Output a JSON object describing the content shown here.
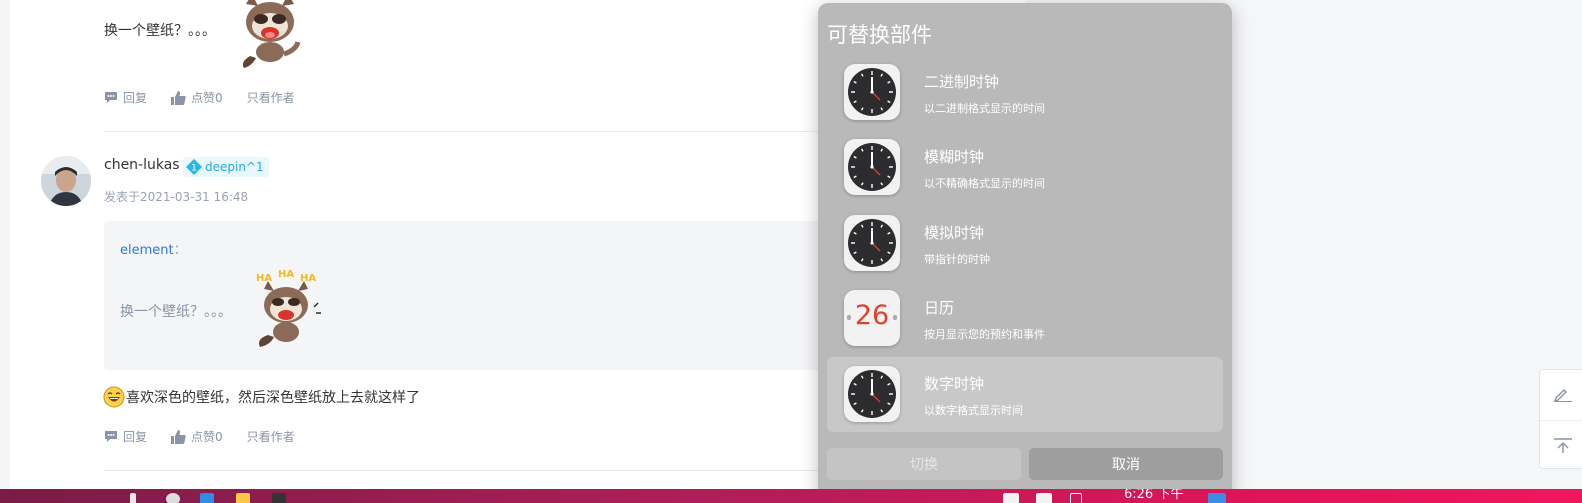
{
  "forum": {
    "top_quote_text": "换一个壁纸？。。。",
    "actions": {
      "reply": "回复",
      "like": "点赞0",
      "author_only": "只看作者"
    },
    "post": {
      "username": "chen-lukas",
      "badge_level": "1",
      "badge_name": "deepin^1",
      "time": "发表于2021-03-31 16:48",
      "quote_author": "element",
      "quote_colon": "：",
      "quote_text": "换一个壁纸？。。。",
      "reply_text": "喜欢深色的壁纸，然后深色壁纸放上去就这样了"
    }
  },
  "panel": {
    "title": "可替换部件",
    "widgets": [
      {
        "name": "二进制时钟",
        "desc": "以二进制格式显示的时间",
        "icon": "clock-icon"
      },
      {
        "name": "模糊时钟",
        "desc": "以不精确格式显示的时间",
        "icon": "clock-icon"
      },
      {
        "name": "模拟时钟",
        "desc": "带指针的时钟",
        "icon": "clock-icon"
      },
      {
        "name": "日历",
        "desc": "按月显示您的预约和事件",
        "icon": "calendar-icon",
        "day": "26"
      },
      {
        "name": "数字时钟",
        "desc": "以数字格式显示时间",
        "icon": "clock-icon",
        "selected": true
      }
    ],
    "switch_label": "切换",
    "cancel_label": "取消"
  },
  "taskbar": {
    "clock": "6:26 下午"
  },
  "colors": {
    "panel_bg": "#b9b9b9",
    "link_blue": "#2e78d2",
    "badge_blue": "#29a8e0",
    "taskbar_pink": "#e01458"
  }
}
